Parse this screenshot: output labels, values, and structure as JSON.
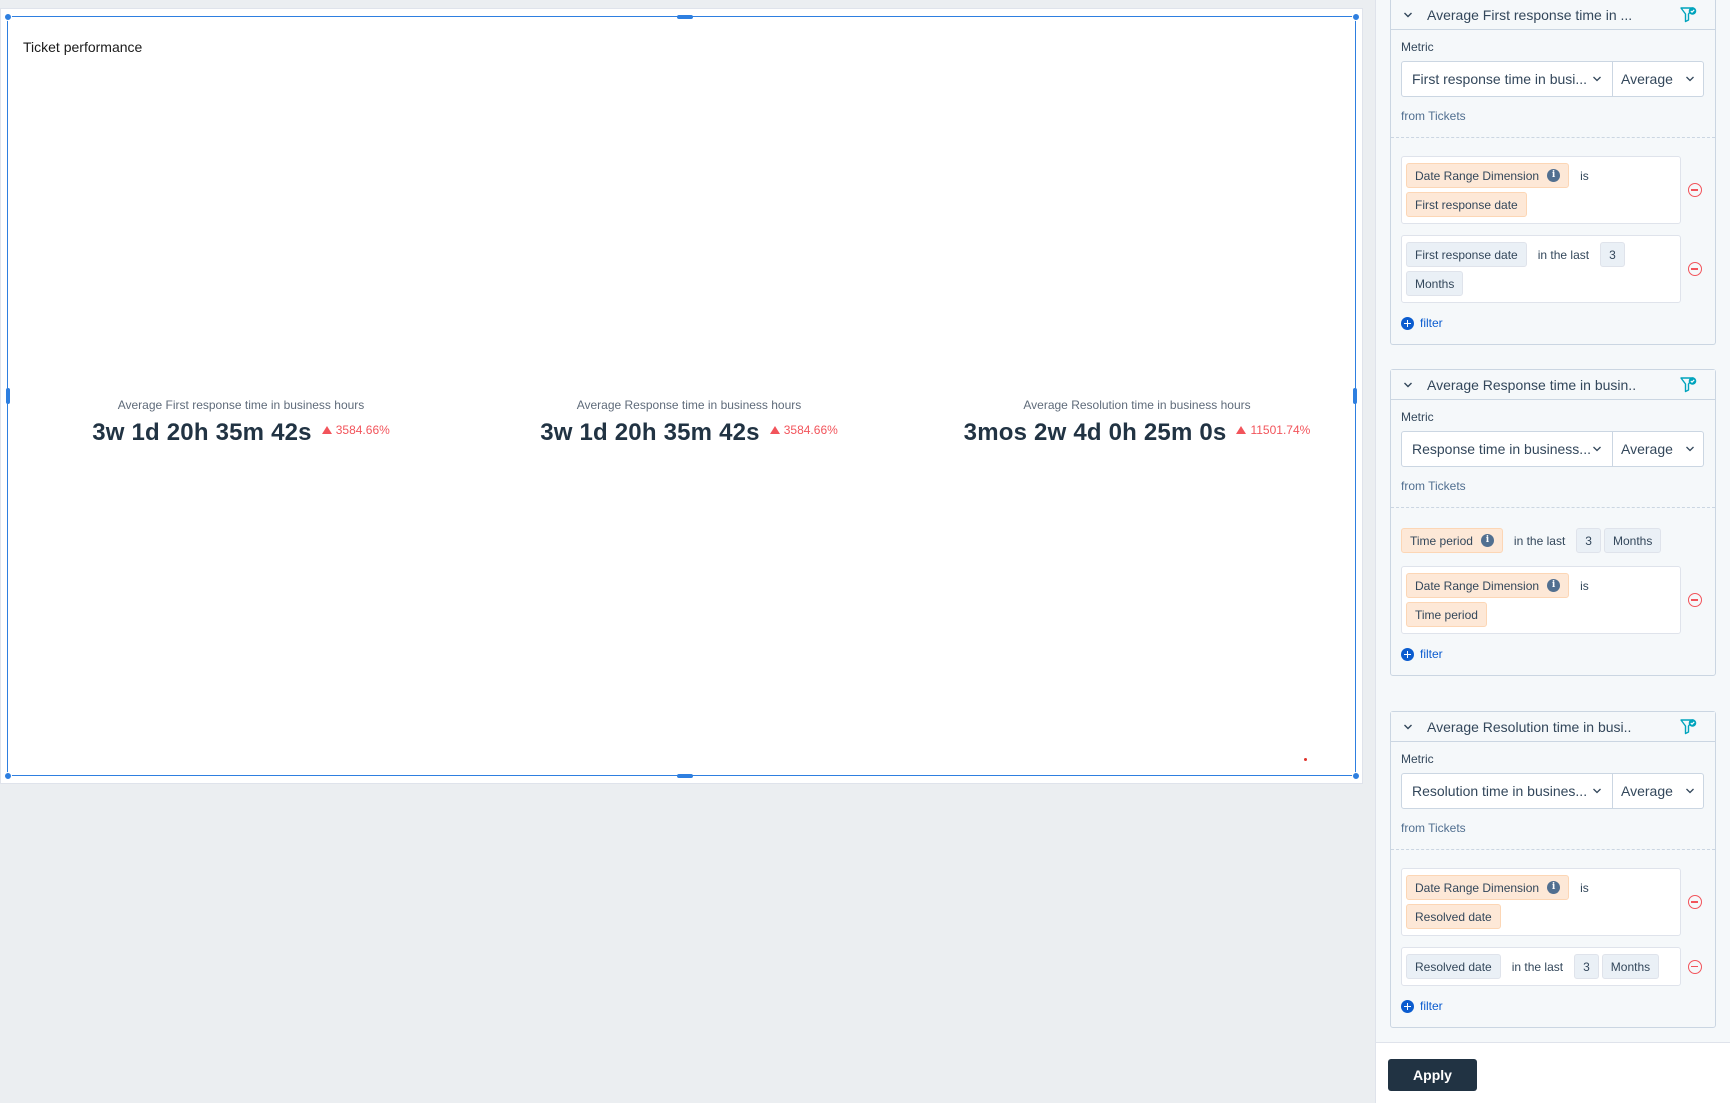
{
  "report": {
    "title": "Ticket performance",
    "kpis": [
      {
        "label": "Average First response time in business hours",
        "value": "3w 1d 20h 35m 42s",
        "change": "3584.66%",
        "direction": "up"
      },
      {
        "label": "Average Response time in business hours",
        "value": "3w 1d 20h 35m 42s",
        "change": "3584.66%",
        "direction": "up"
      },
      {
        "label": "Average Resolution time in business hours",
        "value": "3mos 2w 4d 0h 25m 0s",
        "change": "11501.74%",
        "direction": "up"
      }
    ]
  },
  "panel": {
    "sections": [
      {
        "title": "Average First response time in ...",
        "metric_label": "Metric",
        "metric_value": "First response time in busi...",
        "aggregation": "Average",
        "from": "from Tickets",
        "filters": {
          "f1": {
            "prop": "Date Range Dimension",
            "op": "is",
            "value": "First response date"
          },
          "f2": {
            "prop": "First response date",
            "op": "in the last",
            "num": "3",
            "unit": "Months"
          }
        },
        "add_filter": "filter"
      },
      {
        "title": "Average Response time in busin..",
        "metric_label": "Metric",
        "metric_value": "Response time in business...",
        "aggregation": "Average",
        "from": "from Tickets",
        "filters": {
          "f1": {
            "prop": "Time period",
            "op": "in the last",
            "num": "3",
            "unit": "Months"
          },
          "f2": {
            "prop": "Date Range Dimension",
            "op": "is",
            "value": "Time period"
          }
        },
        "add_filter": "filter"
      },
      {
        "title": "Average Resolution time in busi..",
        "metric_label": "Metric",
        "metric_value": "Resolution time in busines...",
        "aggregation": "Average",
        "from": "from Tickets",
        "filters": {
          "f1": {
            "prop": "Date Range Dimension",
            "op": "is",
            "value": "Resolved date"
          },
          "f2": {
            "prop": "Resolved date",
            "op": "in the last",
            "num": "3",
            "unit": "Months"
          }
        },
        "add_filter": "filter"
      }
    ],
    "apply_label": "Apply"
  },
  "colors": {
    "accent": "#2e7fe0",
    "negative": "#f2545b",
    "dark": "#213343",
    "link": "#0b5ccf",
    "chip_orange": "#fde8d7",
    "chip_grey": "#eaf0f6",
    "funnel_teal": "#00a4bd"
  }
}
